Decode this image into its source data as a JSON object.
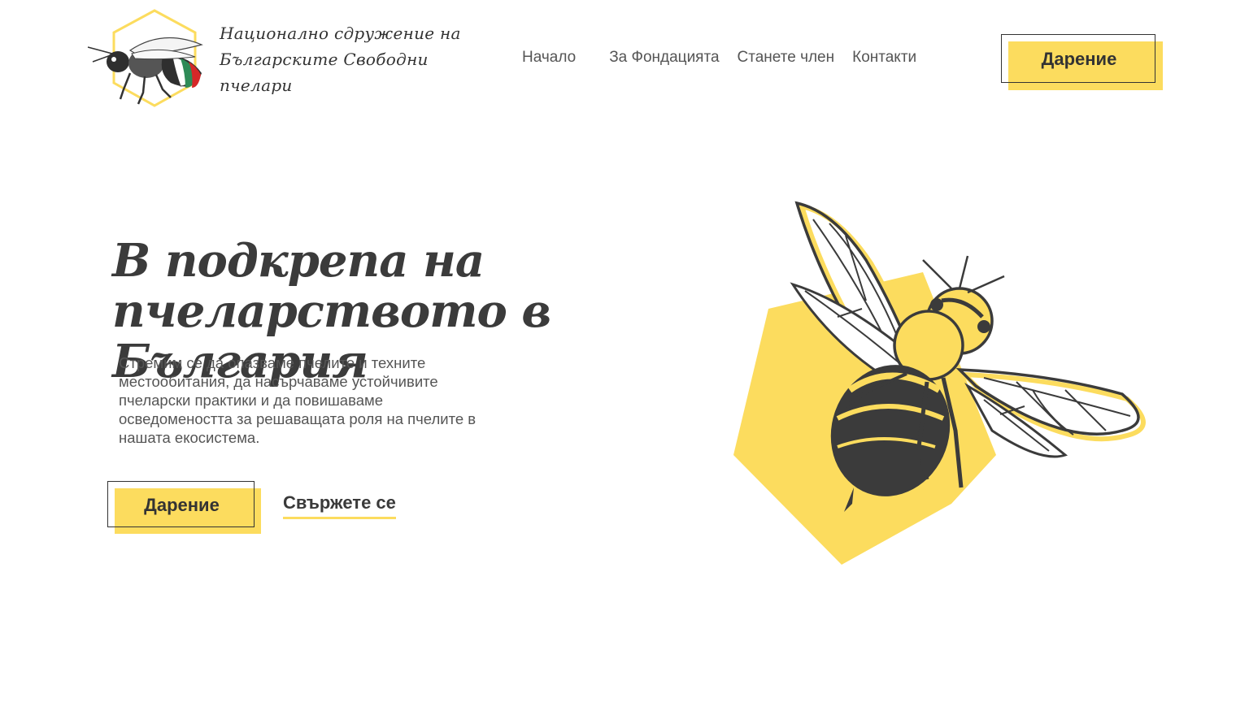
{
  "brand": {
    "line1": "Национално сдружение на",
    "line2": "Българските Свободни пчелари"
  },
  "nav": {
    "items": [
      "Начало",
      "За Фондацията",
      "Станете член",
      "Контакти"
    ],
    "donate_label": "Дарение"
  },
  "hero": {
    "title_line1": "В подкрепа на",
    "title_line2": "пчеларството в България",
    "description": "Стремим се да опазваме пчелите и техните местообитания, да насърчаваме устойчивите пчеларски практики и да повишаваме осведомеността за решаващата роля на пчелите в нашата екосистема.",
    "donate_label": "Дарение",
    "contact_label": "Свържете се"
  },
  "colors": {
    "accent": "#fcdc5e",
    "text": "#3a3a3a",
    "flag_white": "#ffffff",
    "flag_green": "#2e8b57",
    "flag_red": "#d62828"
  },
  "icons": {
    "logo": "bee-hexagon-logo",
    "hero": "bee-illustration"
  }
}
